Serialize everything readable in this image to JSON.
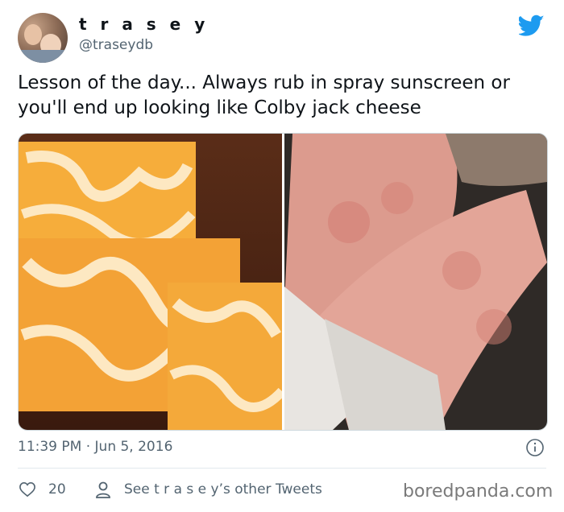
{
  "tweet": {
    "display_name": "t r a s e y",
    "handle": "@traseydb",
    "text": "Lesson of the day... Always rub in spray sunscreen or you'll end up looking like Colby jack cheese",
    "timestamp": "11:39 PM · Jun 5, 2016",
    "likes": "20",
    "see_more": "See t r a s e y’s other Tweets",
    "brand_color": "#1d9bf0"
  },
  "icons": {
    "logo": "twitter-bird-icon",
    "info": "info-icon",
    "like": "heart-icon",
    "profile": "person-icon"
  },
  "watermark": "boredpanda.com"
}
